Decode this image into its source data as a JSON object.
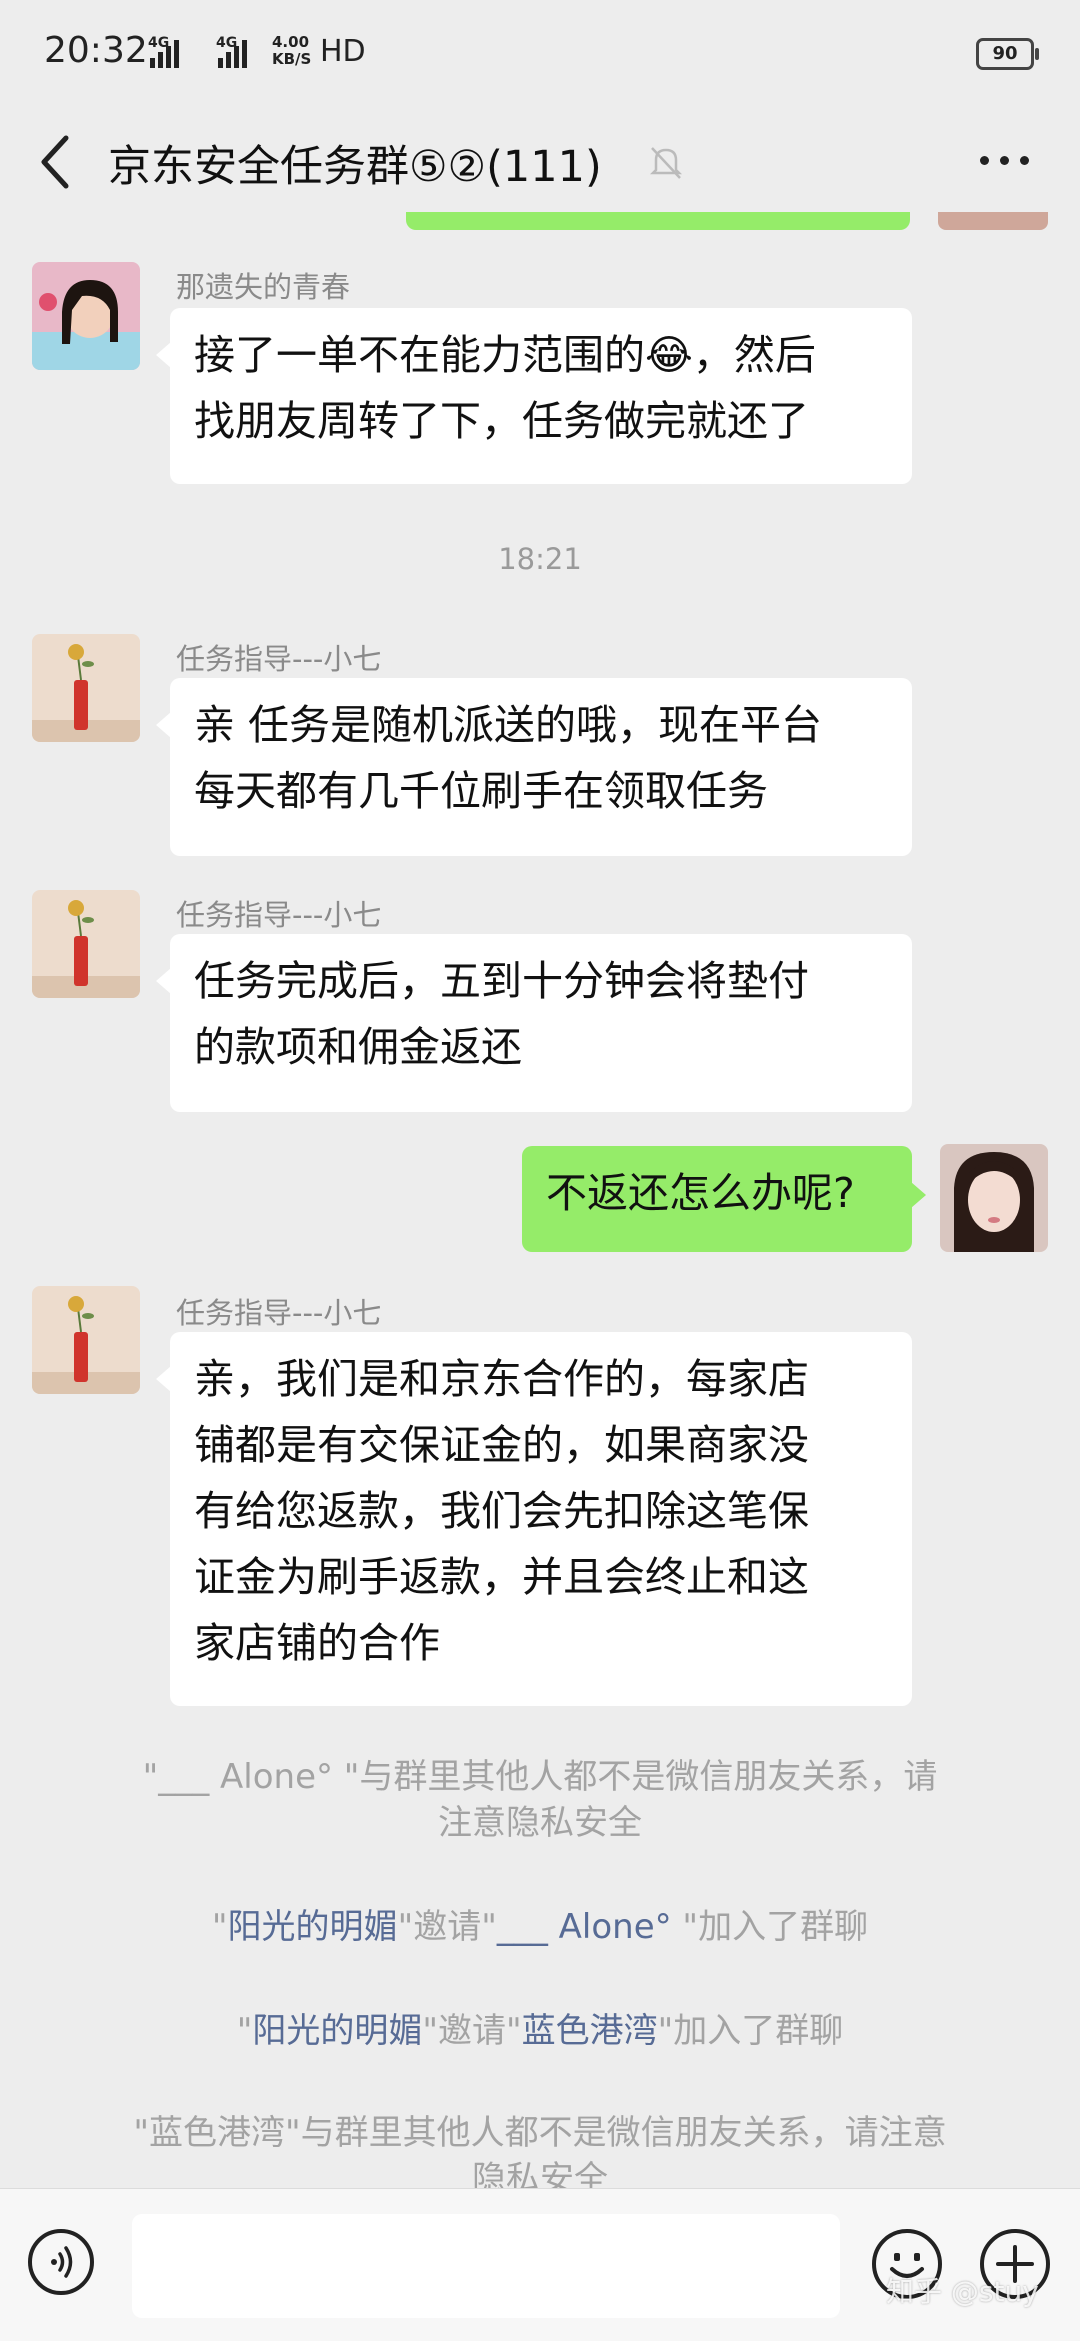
{
  "status_bar": {
    "time": "20:32",
    "net1": "4G",
    "net2": "4G",
    "speed_value": "4.00",
    "speed_unit": "KB/S",
    "hd": "HD",
    "battery": "90"
  },
  "header": {
    "title": "京东安全任务群⑤②(111)",
    "back_icon": "chevron-left-icon",
    "mute_icon": "bell-off-icon",
    "more_icon": "ellipsis-icon"
  },
  "messages": [
    {
      "sender": "那遗失的青春",
      "line1": "接了一单不在能力范围的😂，然后",
      "line2": "找朋友周转了下，任务做完就还了"
    },
    {
      "time": "18:21"
    },
    {
      "sender": "任务指导---小七",
      "line1": "亲 任务是随机派送的哦，现在平台",
      "line2": "每天都有几千位刷手在领取任务"
    },
    {
      "sender": "任务指导---小七",
      "line1": "任务完成后，五到十分钟会将垫付",
      "line2": "的款项和佣金返还"
    },
    {
      "text": "不返还怎么办呢?"
    },
    {
      "sender": "任务指导---小七",
      "line1": "亲，我们是和京东合作的，每家店",
      "line2": "铺都是有交保证金的，如果商家没",
      "line3": "有给您返款，我们会先扣除这笔保",
      "line4": "证金为刷手返款，并且会终止和这",
      "line5": "家店铺的合作"
    }
  ],
  "system": [
    {
      "line1": "\"___ Alone°  \"与群里其他人都不是微信朋友关系，请",
      "line2": "注意隐私安全"
    },
    {
      "q1": "\"",
      "name1": "阳光的明媚",
      "mid": "\"邀请\"",
      "name2": "___ Alone°",
      "end": " \"加入了群聊"
    },
    {
      "q1": "\"",
      "name1": "阳光的明媚",
      "mid": "\"邀请\"",
      "name2": "蓝色港湾",
      "end": "\"加入了群聊"
    },
    {
      "line1": "\"蓝色港湾\"与群里其他人都不是微信朋友关系，请注意",
      "line2": "隐私安全"
    }
  ],
  "bottom_bar": {
    "voice_icon": "voice-icon",
    "emoji_icon": "emoji-icon",
    "plus_icon": "plus-icon"
  },
  "watermark": "知乎 @stuy"
}
